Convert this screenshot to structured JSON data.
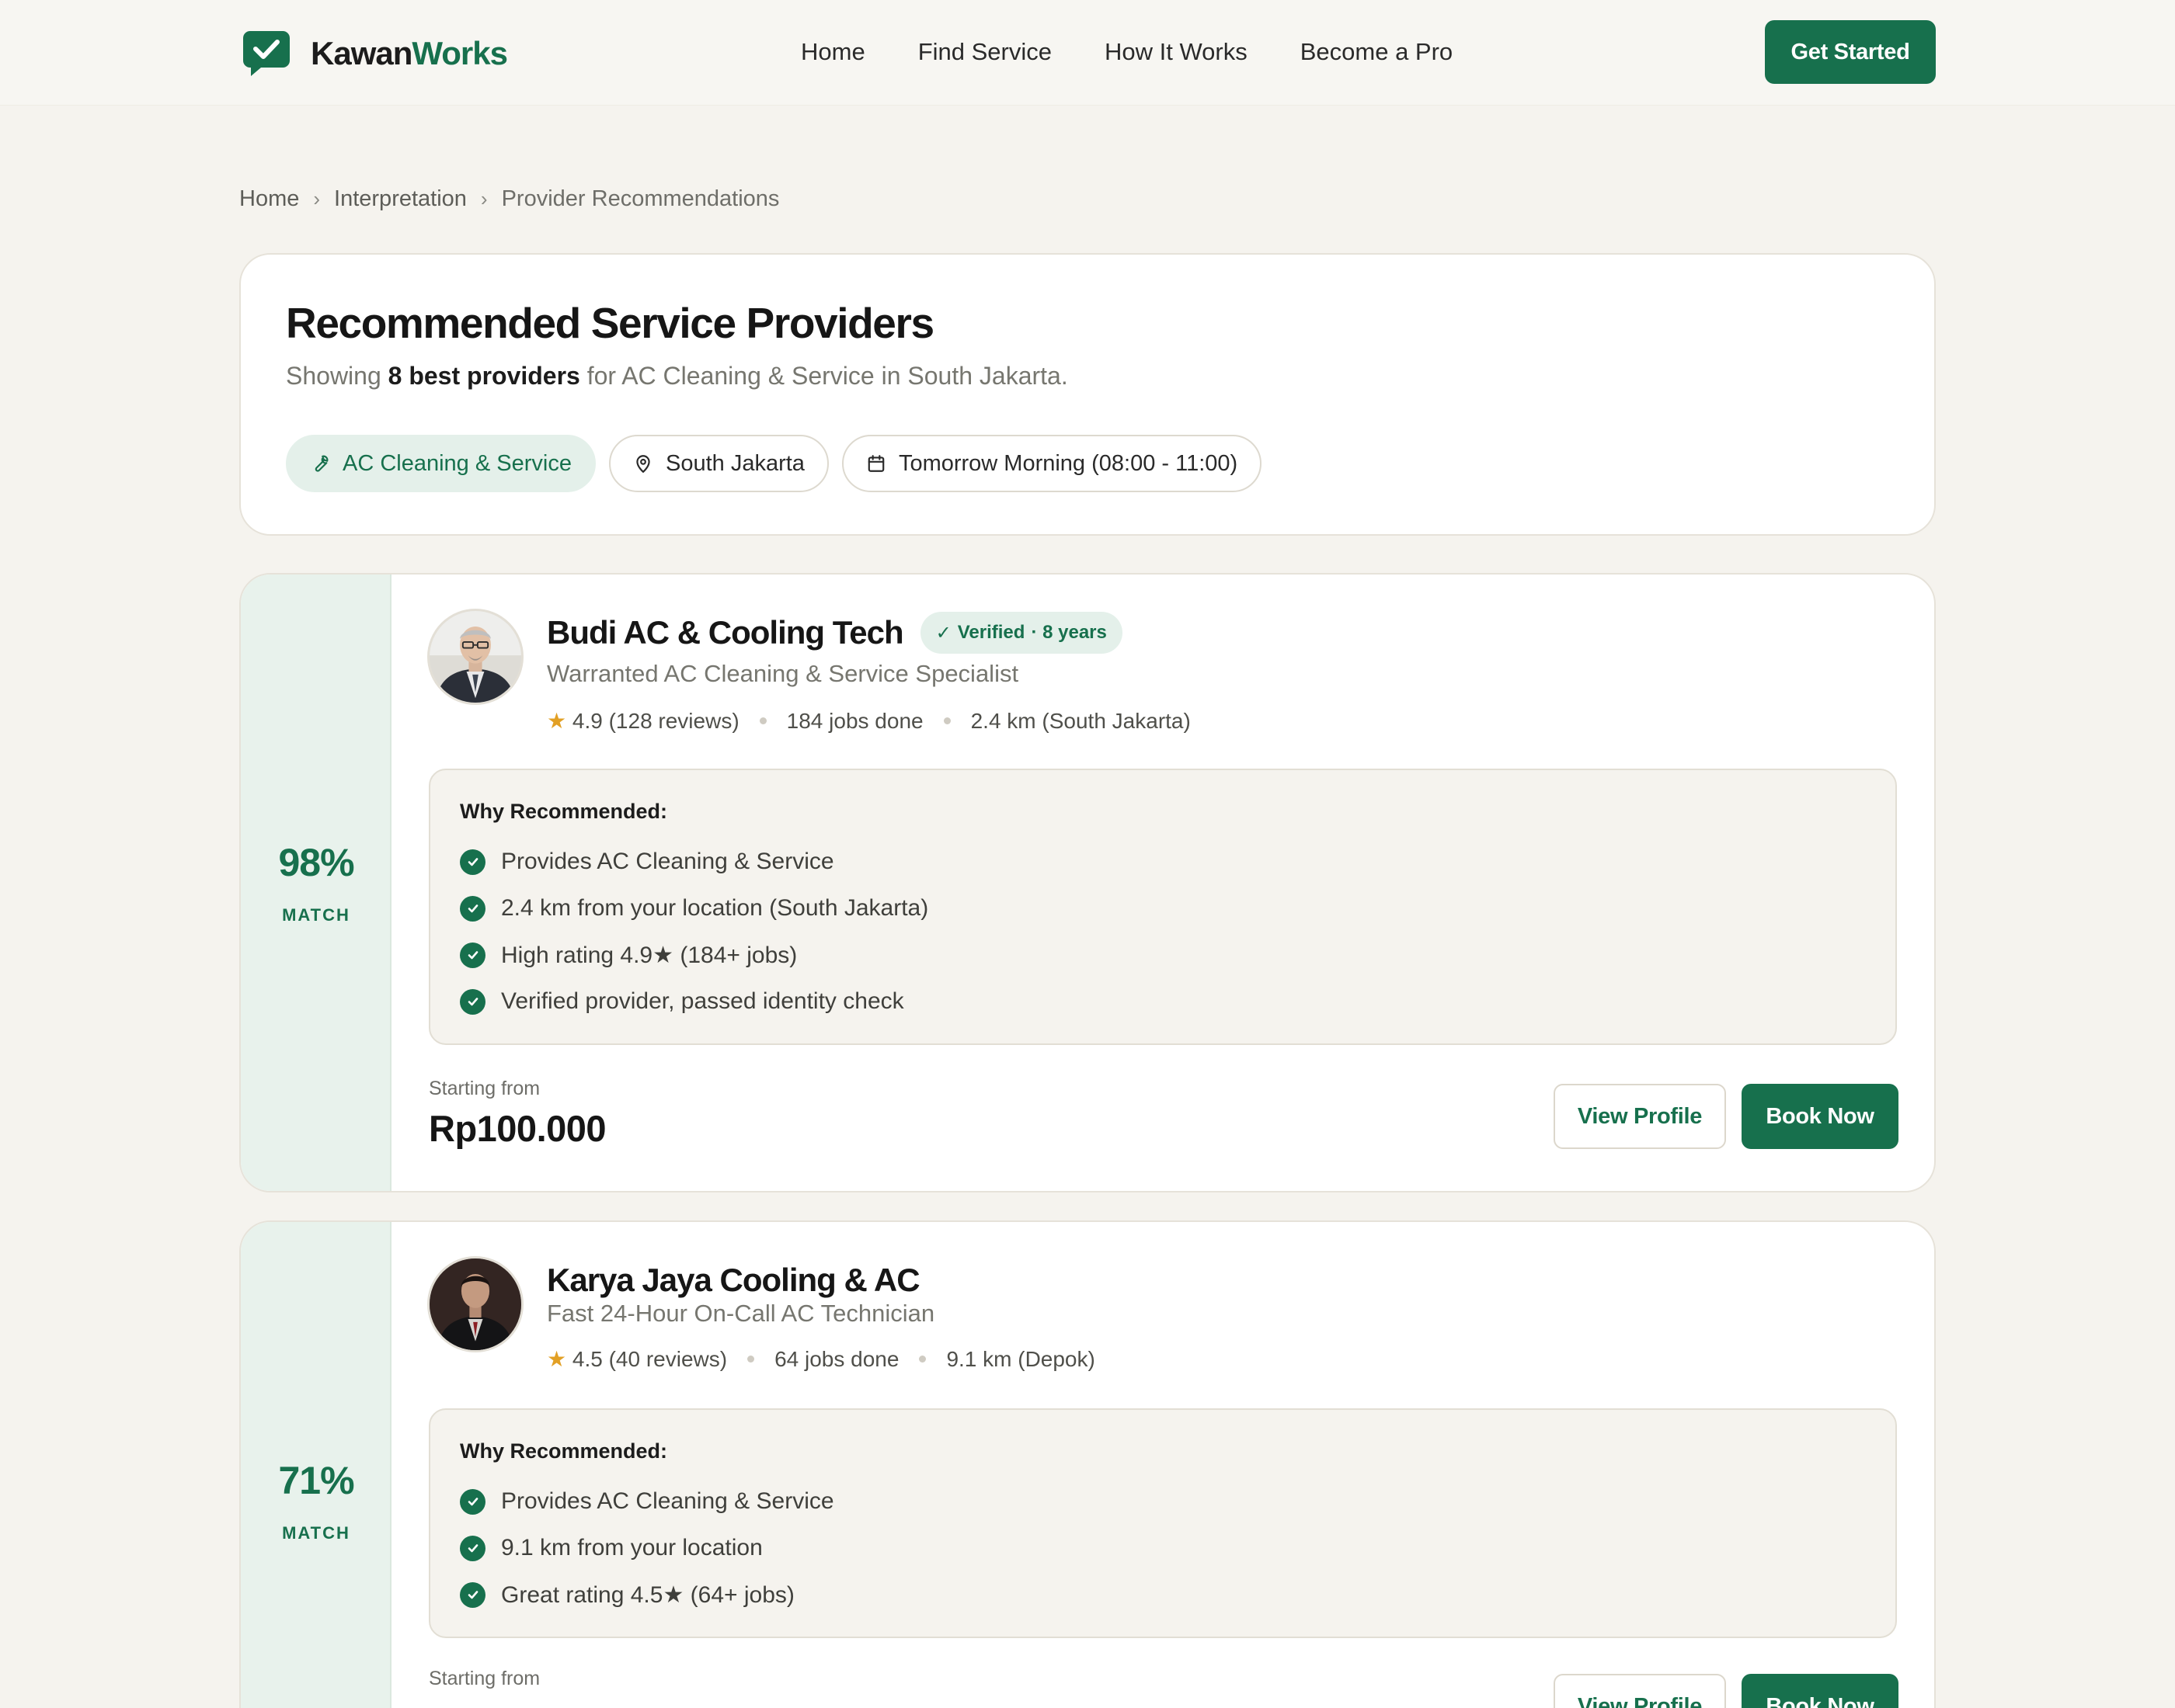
{
  "brand": {
    "name_part1": "Kawan",
    "name_part2": "Works",
    "color": "#17704d"
  },
  "nav": [
    "Home",
    "Find Service",
    "How It Works",
    "Become a Pro"
  ],
  "header": {
    "cta_label": "Get Started"
  },
  "breadcrumb": [
    "Home",
    "Interpretation",
    "Provider Recommendations"
  ],
  "summary": {
    "title": "Recommended Service Providers",
    "sub_prefix": "Showing",
    "sub_count": "8 best providers",
    "sub_suffix": "for AC Cleaning & Service in South Jakarta.",
    "chips": [
      {
        "label": "AC Cleaning & Service",
        "icon": "wrench-icon",
        "active": true
      },
      {
        "label": "South Jakarta",
        "icon": "map-pin-icon",
        "active": false
      },
      {
        "label": "Tomorrow Morning (08:00 - 11:00)",
        "icon": "calendar-icon",
        "active": false
      }
    ]
  },
  "providers": [
    {
      "match_value": "98%",
      "match_label": "MATCH",
      "name": "Budi AC & Cooling Tech",
      "badge_verified": "Verified",
      "badge_years": "· 8  years",
      "tagline": "Warranted AC Cleaning & Service Specialist",
      "rating": "4.9 (128 reviews)",
      "jobs": "184 jobs done",
      "distance": "2.4 km (South Jakarta)",
      "why_title": "Why Recommended:",
      "reasons": [
        "Provides AC Cleaning & Service",
        "2.4 km from your location (South Jakarta)",
        "High rating 4.9★ (184+ jobs)",
        "Verified provider, passed identity check"
      ],
      "price_label": "Starting from",
      "price": "Rp100.000",
      "view_label": "View Profile",
      "book_label": "Book Now"
    },
    {
      "match_value": "71%",
      "match_label": "MATCH",
      "name": "Karya Jaya Cooling & AC",
      "tagline": "Fast 24-Hour On-Call AC Technician",
      "rating": "4.5 (40 reviews)",
      "jobs": "64 jobs done",
      "distance": "9.1 km (Depok)",
      "why_title": "Why Recommended:",
      "reasons": [
        "Provides AC Cleaning & Service",
        "9.1 km from your location",
        "Great rating 4.5★ (64+ jobs)"
      ],
      "price_label": "Starting from",
      "view_label": "View Profile",
      "book_label": "Book Now"
    }
  ]
}
